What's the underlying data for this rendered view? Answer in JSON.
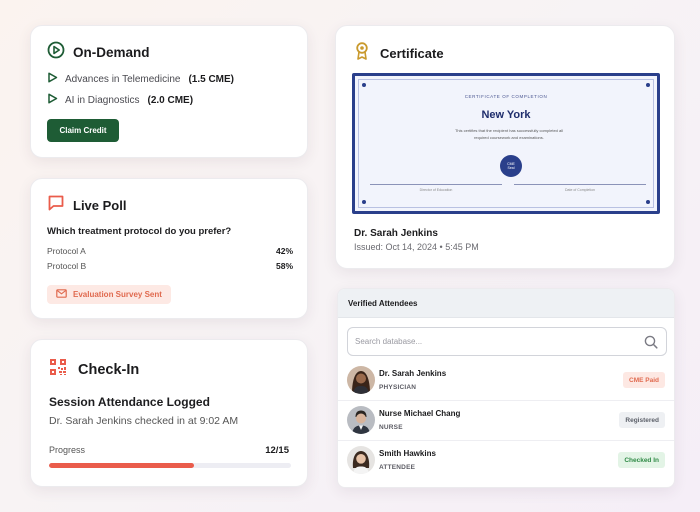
{
  "on_demand": {
    "title": "On-Demand",
    "items": [
      {
        "label": "Advances in Telemedicine",
        "credits": "(1.5 CME)"
      },
      {
        "label": "AI in Diagnostics",
        "credits": "(2.0 CME)"
      }
    ],
    "claim_button": "Claim Credit"
  },
  "live_poll": {
    "title": "Live Poll",
    "question": "Which treatment protocol do you prefer?",
    "options": [
      {
        "label": "Protocol A",
        "percent": "42%"
      },
      {
        "label": "Protocol B",
        "percent": "58%"
      }
    ],
    "survey_badge": "Evaluation Survey Sent"
  },
  "check_in": {
    "title": "Check-In",
    "session_title": "Session Attendance Logged",
    "message": "Dr. Sarah Jenkins checked in at 9:02 AM",
    "progress_label": "Progress",
    "progress_text": "12/15",
    "progress_fraction": 0.6
  },
  "certificate": {
    "title": "Certificate",
    "doc_heading": "CERTIFICATE OF COMPLETION",
    "doc_city": "New York",
    "doc_body": "This certifies that the recipient has successfully completed all required coursework and examinations.",
    "seal_line1": "CME",
    "seal_line2": "Seal",
    "sig_left": "Director of Education",
    "sig_right": "Date of Completion",
    "recipient": "Dr. Sarah Jenkins",
    "issued": "Issued: Oct 14, 2024 • 5:45 PM"
  },
  "attendees": {
    "title": "Verified Attendees",
    "search_placeholder": "Search database...",
    "rows": [
      {
        "name": "Dr. Sarah Jenkins",
        "role": "PHYSICIAN",
        "status": "CME Paid",
        "status_bg": "#fde8e3",
        "status_color": "#e06a4f"
      },
      {
        "name": "Nurse Michael Chang",
        "role": "NURSE",
        "status": "Registered",
        "status_bg": "#eef0f3",
        "status_color": "#5b5f68"
      },
      {
        "name": "Smith Hawkins",
        "role": "ATTENDEE",
        "status": "Checked In",
        "status_bg": "#e3f4e6",
        "status_color": "#2f8a46"
      }
    ]
  },
  "colors": {
    "brand_green": "#1e5c35",
    "accent_coral": "#ea5c4b",
    "certificate_navy": "#2a3f8b",
    "award_gold": "#c99a2e"
  }
}
